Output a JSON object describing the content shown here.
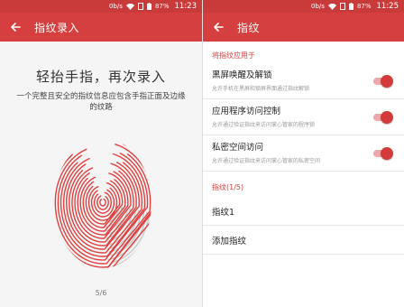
{
  "status_bar": {
    "left_screen": {
      "net_speed": "0b/s",
      "battery": "87%",
      "time": "11:23"
    },
    "right_screen": {
      "net_speed": "0b/s",
      "battery": "87%",
      "time": "11:25"
    }
  },
  "enroll_screen": {
    "title": "指纹录入",
    "heading": "轻抬手指，再次录入",
    "description": "一个完整且安全的指纹信息应包含手指正面及边缘的纹路",
    "progress": "5/6",
    "progress_fraction": 0.83
  },
  "settings_screen": {
    "title": "指纹",
    "section_apply": "将指纹应用于",
    "items": [
      {
        "title": "黑屏唤醒及解锁",
        "subtitle": "允许手机在黑屏和锁屏界面通过指纹解锁",
        "enabled": true
      },
      {
        "title": "应用程序访问控制",
        "subtitle": "允许通过验证指纹来访问掌心管家的程序锁",
        "enabled": true
      },
      {
        "title": "私密空间访问",
        "subtitle": "允许通过验证指纹来访问掌心管家的私密空间",
        "enabled": true
      }
    ],
    "section_fingerprints": "指纹(1/5)",
    "fingerprint_entry": "指纹1",
    "add_fingerprint": "添加指纹"
  },
  "colors": {
    "accent": "#d53f3f",
    "status_bar": "#c93a3a",
    "toggle_track": "#eaa8a8",
    "toggle_knob": "#d33b3b",
    "fingerprint_done": "#e04040",
    "fingerprint_pending": "#c8c8c8"
  }
}
